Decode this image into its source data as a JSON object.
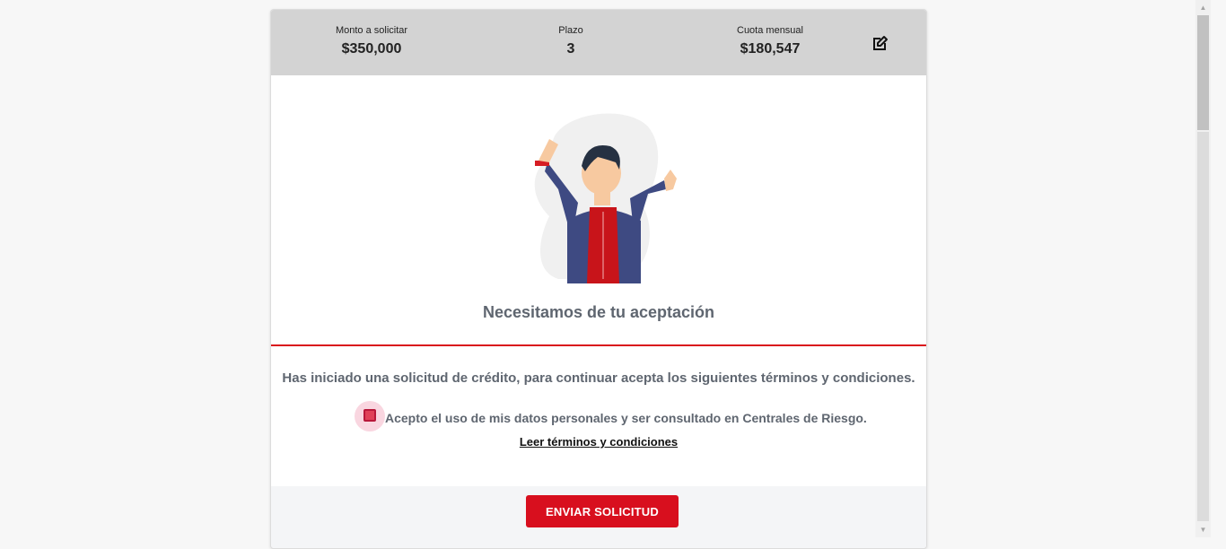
{
  "summary": {
    "amount_label": "Monto a solicitar",
    "amount_value": "$350,000",
    "term_label": "Plazo",
    "term_value": "3",
    "fee_label": "Cuota mensual",
    "fee_value": "$180,547",
    "edit_icon": "edit-icon"
  },
  "main": {
    "title": "Necesitamos de tu aceptación",
    "intro": "Has iniciado una solicitud de crédito, para continuar acepta los siguientes términos y condiciones.",
    "checkbox_label": "Acepto el uso de mis datos personales y ser consultado en Centrales de Riesgo.",
    "terms_link": "Leer términos y condiciones",
    "submit_label": "ENVIAR SOLICITUD"
  },
  "colors": {
    "accent": "#d80f1e",
    "summary_bg": "#d3d3d3",
    "text_muted": "#5f6670"
  }
}
